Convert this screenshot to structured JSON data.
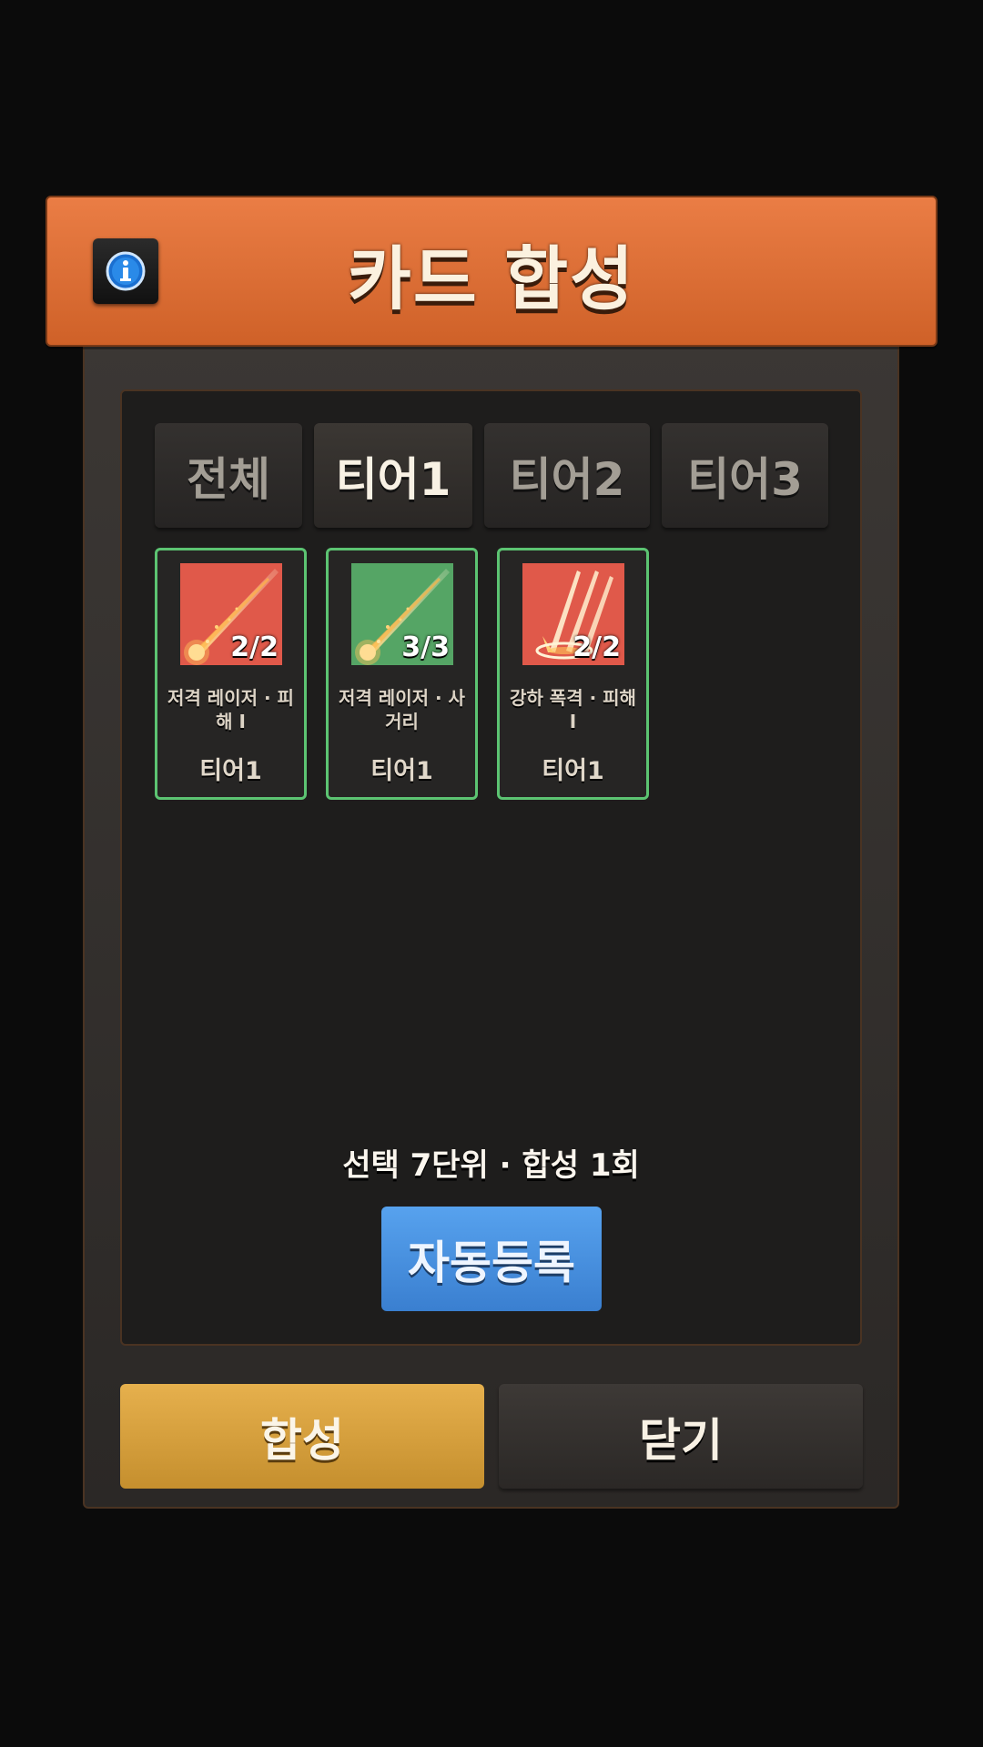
{
  "header": {
    "title": "카드 합성",
    "info_icon": "info-icon"
  },
  "tabs": [
    {
      "label": "전체",
      "active": false
    },
    {
      "label": "티어1",
      "active": true
    },
    {
      "label": "티어2",
      "active": false
    },
    {
      "label": "티어3",
      "active": false
    }
  ],
  "cards": [
    {
      "name": "저격 레이저 · 피해 I",
      "count": "2/2",
      "tier": "티어1",
      "bg_color": "#e0594a",
      "icon": "laser-shot-icon"
    },
    {
      "name": "저격 레이저 · 사거리",
      "count": "3/3",
      "tier": "티어1",
      "bg_color": "#55a565",
      "icon": "laser-shot-icon"
    },
    {
      "name": "강하 폭격 · 피해 I",
      "count": "2/2",
      "tier": "티어1",
      "bg_color": "#e0594a",
      "icon": "air-strike-icon"
    }
  ],
  "summary": "선택 7단위 · 합성 1회",
  "buttons": {
    "auto_register": "자동등록",
    "synthesize": "합성",
    "close": "닫기"
  },
  "colors": {
    "header": "#e5743b",
    "card_border": "#5cc472",
    "auto_button": "#4a90e2",
    "synth_button": "#d9a13f"
  }
}
